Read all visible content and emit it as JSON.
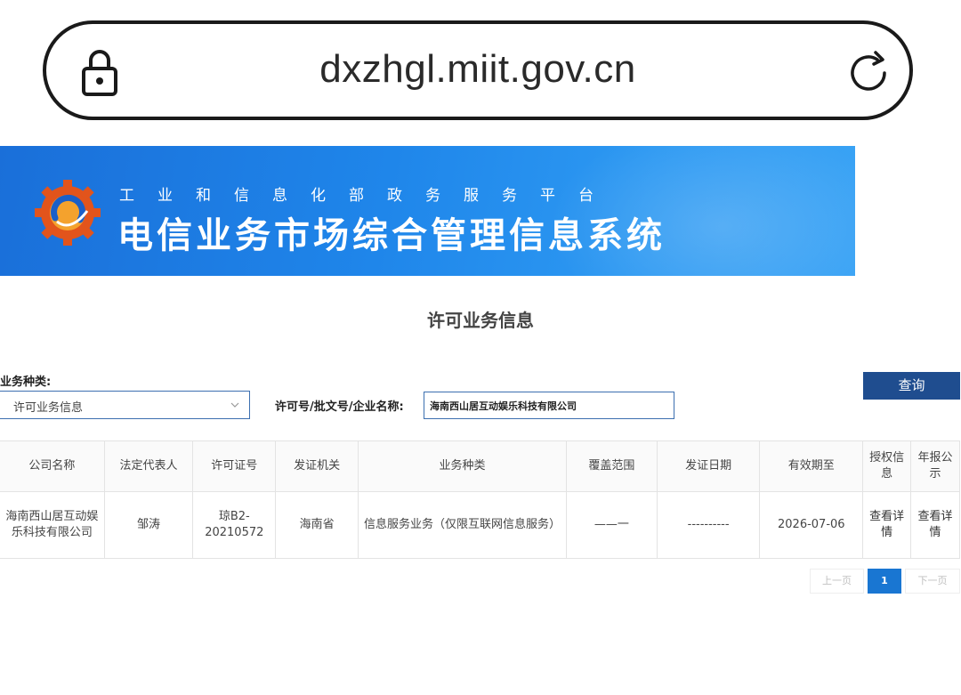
{
  "browser": {
    "url": "dxzhgl.miit.gov.cn"
  },
  "banner": {
    "subtitle": "工业和信息化部政务服务平台",
    "title": "电信业务市场综合管理信息系统"
  },
  "page": {
    "section_title": "许可业务信息"
  },
  "filters": {
    "type_label": "业务种类:",
    "type_value": "许可业务信息",
    "query_label": "许可号/批文号/企业名称:",
    "query_value": "海南西山居互动娱乐科技有限公司",
    "search_label": "查询"
  },
  "table": {
    "headers": [
      "公司名称",
      "法定代表人",
      "许可证号",
      "发证机关",
      "业务种类",
      "覆盖范围",
      "发证日期",
      "有效期至",
      "授权信息",
      "年报公示"
    ],
    "rows": [
      {
        "company": "海南西山居互动娱乐科技有限公司",
        "legal_rep": "邹涛",
        "license_no": "琼B2-20210572",
        "issuer": "海南省",
        "business_type": "信息服务业务（仅限互联网信息服务）",
        "coverage": "——一",
        "issue_date": "----------",
        "valid_until": "2026-07-06",
        "auth_info": "查看详情",
        "annual_report": "查看详情"
      }
    ]
  },
  "pagination": {
    "prev": "上一页",
    "current": "1",
    "next": "下一页"
  },
  "colors": {
    "banner_blue": "#1f86ea",
    "button_navy": "#1f4d8f",
    "active_page": "#1976d2"
  },
  "icons": {
    "lock": "lock-icon",
    "reload": "reload-icon",
    "logo": "miit-logo-icon",
    "chevron": "chevron-down-icon"
  }
}
